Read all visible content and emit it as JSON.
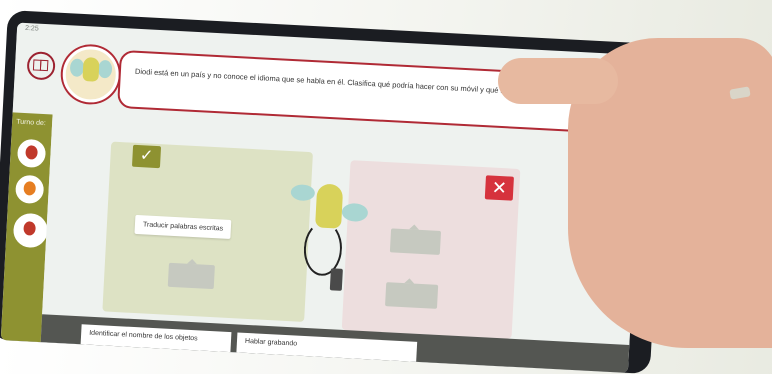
{
  "status": {
    "time": "2:25"
  },
  "dialog": {
    "text": "Diodi está en un país y no conoce el idioma que se habla en él. Clasifica qué podría hacer con su móvil y qué no"
  },
  "sidebar": {
    "turn_label": "Turno de:"
  },
  "cards": {
    "placed": "Traducir palabras escritas"
  },
  "bottom_cards": [
    "Identificar el nombre de los objetos",
    "Hablar grabando"
  ],
  "badges": {
    "correct_symbol": "✓",
    "wrong_symbol": "✕"
  },
  "colors": {
    "accent_red": "#b02a35",
    "olive": "#8e9231",
    "panel_yes": "#dde2c4",
    "panel_no": "#eddede"
  }
}
